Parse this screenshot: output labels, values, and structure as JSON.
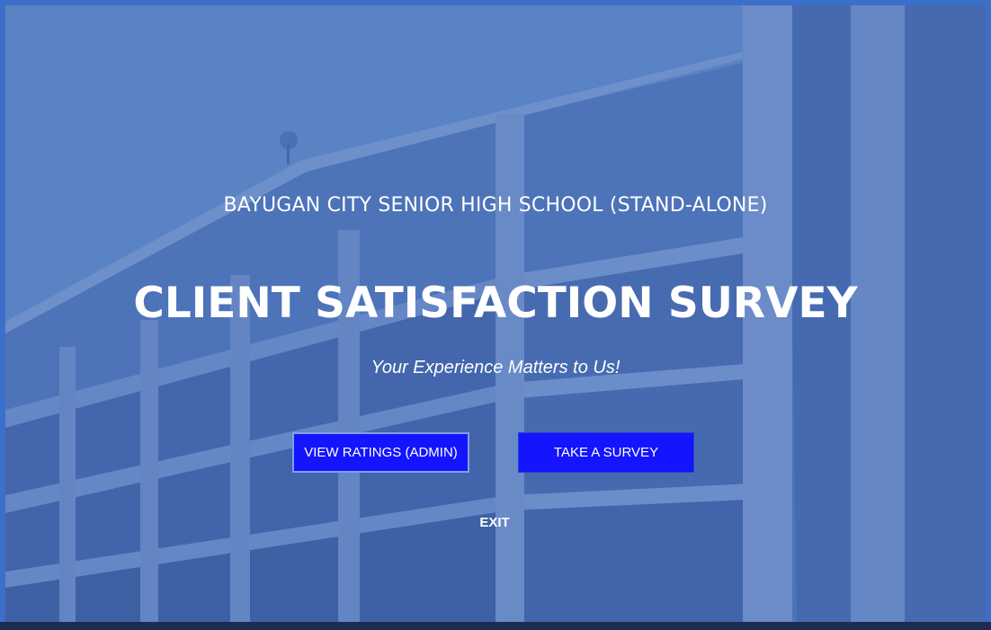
{
  "school_name": "BAYUGAN CITY SENIOR HIGH SCHOOL (STAND-ALONE)",
  "title": "CLIENT SATISFACTION SURVEY",
  "tagline": "Your Experience Matters to Us!",
  "buttons": {
    "admin_label": "VIEW RATINGS (ADMIN)",
    "survey_label": "TAKE A SURVEY",
    "exit_label": "EXIT"
  },
  "colors": {
    "button_bg": "#1414ff",
    "frame": "#3c6fc9",
    "text": "#ffffff"
  }
}
